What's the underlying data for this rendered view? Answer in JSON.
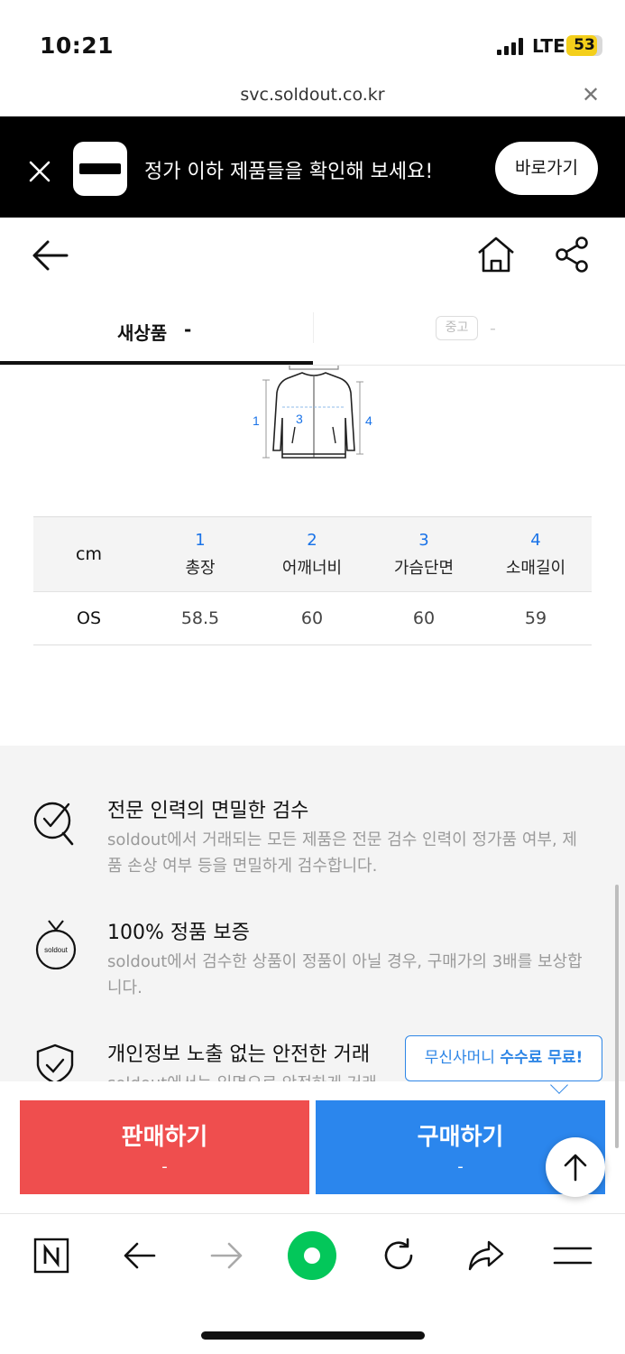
{
  "status": {
    "time": "10:21",
    "network": "LTE",
    "battery": "53"
  },
  "browser": {
    "url": "svc.soldout.co.kr"
  },
  "banner": {
    "text": "정가 이하 제품들을 확인해 보세요!",
    "button": "바로가기"
  },
  "tabs": {
    "new_label": "새상품",
    "new_value": "-",
    "used_badge": "중고",
    "used_value": "-"
  },
  "size_chart": {
    "diagram_labels": [
      "1",
      "3",
      "4"
    ],
    "unit": "cm",
    "columns": [
      {
        "num": "1",
        "label": "총장"
      },
      {
        "num": "2",
        "label": "어깨너비"
      },
      {
        "num": "3",
        "label": "가슴단면"
      },
      {
        "num": "4",
        "label": "소매길이"
      }
    ],
    "rows": [
      {
        "size": "OS",
        "values": [
          "58.5",
          "60",
          "60",
          "59"
        ]
      }
    ]
  },
  "info": [
    {
      "icon": "inspection-icon",
      "title": "전문 인력의 면밀한 검수",
      "desc": "soldout에서 거래되는 모든 제품은 전문 검수 인력이 정가품 여부, 제품 손상 여부 등을 면밀하게 검수합니다."
    },
    {
      "icon": "authentic-badge-icon",
      "badge_text": "soldout",
      "title": "100% 정품 보증",
      "desc": "soldout에서 검수한 상품이 정품이 아닐 경우, 구매가의 3배를 보상합니다."
    },
    {
      "icon": "shield-check-icon",
      "title": "개인정보 노출 없는 안전한 거래",
      "desc": "soldout에서는 익명으로 안전하게 거래"
    }
  ],
  "tooltip": {
    "prefix": "무신사머니 ",
    "emphasis": "수수료 무료!"
  },
  "actions": {
    "sell_label": "판매하기",
    "sell_price": "-",
    "buy_label": "구매하기",
    "buy_price": "-"
  },
  "colors": {
    "sell": "#ef4e4e",
    "buy": "#2b86ed",
    "accent_blue": "#1a73e8",
    "banner_bg": "#000000",
    "browser_logo": "#03c75a"
  },
  "toolbar_icons": [
    "naver-icon",
    "back-arrow-icon",
    "forward-arrow-icon",
    "green-dot-icon",
    "reload-icon",
    "share-icon",
    "menu-icon"
  ]
}
